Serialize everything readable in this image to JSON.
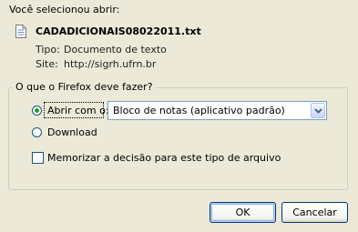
{
  "dialog": {
    "intro": "Você selecionou abrir:",
    "file_name": "CADADICIONAIS08022011.txt",
    "type_label": "Tipo:",
    "type_value": "Documento de texto",
    "site_label": "Site:",
    "site_value": "http://sigrh.ufrn.br"
  },
  "action_group": {
    "legend": "O que o Firefox deve fazer?",
    "open_with_label": "Abrir com o:",
    "open_with_selected": true,
    "application_select_value": "Bloco de notas (aplicativo padrão)",
    "download_label": "Download",
    "download_selected": false,
    "remember_label": "Memorizar a decisão para este tipo de arquivo",
    "remember_checked": false
  },
  "buttons": {
    "ok": "OK",
    "cancel": "Cancelar"
  },
  "icons": {
    "file": "text-file-icon",
    "dropdown": "chevron-down-icon"
  },
  "colors": {
    "dialog_background": "#ECE9D8",
    "radio_selected": "#21A121",
    "control_border": "#1C5180"
  }
}
